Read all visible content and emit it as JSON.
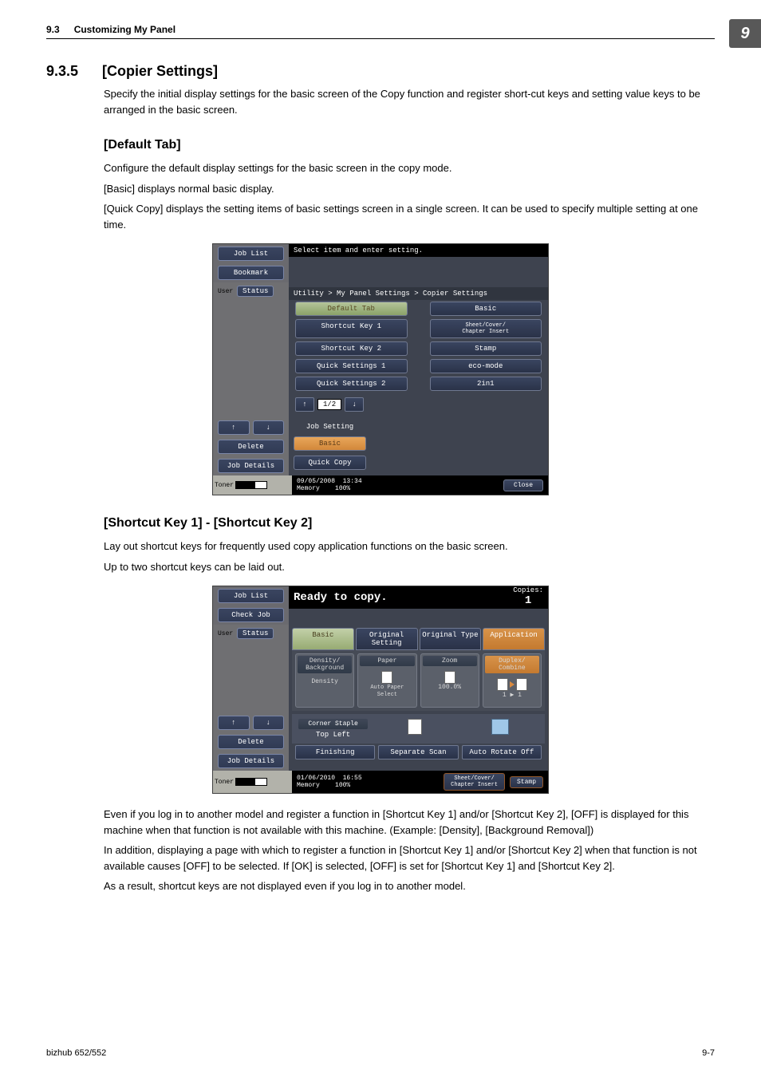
{
  "header": {
    "section_no": "9.3",
    "section_title": "Customizing My Panel",
    "chapter": "9"
  },
  "sec": {
    "num": "9.3.5",
    "title": "[Copier Settings]"
  },
  "intro": "Specify the initial display settings for the basic screen of the Copy function and register short-cut keys and setting value keys to be arranged in the basic screen.",
  "default_tab": {
    "heading": "[Default Tab]",
    "p1": "Configure the default display settings for the basic screen in the copy mode.",
    "p2": "[Basic] displays normal basic display.",
    "p3": "[Quick Copy] displays the setting items of basic settings screen in a single screen. It can be used to specify multiple setting at one time."
  },
  "shot1": {
    "side": {
      "jobList": "Job List",
      "bookmark": "Bookmark",
      "user": "User",
      "status": "Status",
      "delete": "Delete",
      "jobDetails": "Job Details",
      "up": "↑",
      "down": "↓"
    },
    "toner": "Toner",
    "headline": "Select item and enter setting.",
    "breadcrumb": "Utility > My Panel Settings > Copier Settings",
    "rows": [
      [
        "Default Tab",
        "Basic"
      ],
      [
        "Shortcut Key 1",
        "Sheet/Cover/\nChapter Insert"
      ],
      [
        "Shortcut Key 2",
        "Stamp"
      ],
      [
        "Quick Settings 1",
        "eco-mode"
      ],
      [
        "Quick Settings 2",
        "2in1"
      ]
    ],
    "right": {
      "jobSetting": "Job Setting",
      "basic": "Basic",
      "quickCopy": "Quick Copy"
    },
    "pager": {
      "up": "↑",
      "page": "1/2",
      "down": "↓"
    },
    "footer": {
      "date": "09/05/2008",
      "time": "13:34",
      "memory": "Memory",
      "pct": "100%",
      "close": "Close"
    }
  },
  "shortcut": {
    "heading": "[Shortcut Key 1] - [Shortcut Key 2]",
    "p1": "Lay out shortcut keys for frequently used copy application functions on the basic screen.",
    "p2": "Up to two shortcut keys can be laid out."
  },
  "shot2": {
    "side": {
      "jobList": "Job List",
      "checkJob": "Check Job",
      "user": "User",
      "status": "Status",
      "delete": "Delete",
      "jobDetails": "Job Details",
      "up": "↑",
      "down": "↓"
    },
    "toner": "Toner",
    "headline": "Ready to copy.",
    "copies": "Copies:",
    "copiesVal": "1",
    "tabs": {
      "basic": "Basic",
      "orig": "Original Setting",
      "type": "Original Type",
      "app": "Application"
    },
    "cols": {
      "density": {
        "h": "Density/\nBackground",
        "c": "Density"
      },
      "paper": {
        "h": "Paper",
        "c": "Auto Paper\nSelect"
      },
      "zoom": {
        "h": "Zoom",
        "c": "100.0%"
      },
      "duplex": {
        "h": "Duplex/\nCombine",
        "c": "1 ▶ 1"
      }
    },
    "act": {
      "cs": "Corner Staple",
      "sub": "Top Left",
      "fin": "Finishing",
      "sep": "Separate Scan",
      "rot": "Auto Rotate Off"
    },
    "footer": {
      "date": "01/06/2010",
      "time": "16:55",
      "memory": "Memory",
      "pct": "100%",
      "scc": "Sheet/Cover/\nChapter Insert",
      "stamp": "Stamp"
    }
  },
  "aftertext": {
    "p1": "Even if you log in to another model and register a function in [Shortcut Key 1] and/or [Shortcut Key 2], [OFF] is displayed for this machine when that function is not available with this machine. (Example: [Density], [Background Removal])",
    "p2": "In addition, displaying a page with which to register a function in [Shortcut Key 1] and/or [Shortcut Key 2] when that function is not available causes [OFF] to be selected. If [OK] is selected, [OFF] is set for [Shortcut Key 1] and [Shortcut Key 2].",
    "p3": "As a result, shortcut keys are not displayed even if you log in to another model."
  },
  "footer": {
    "left": "bizhub 652/552",
    "right": "9-7"
  }
}
